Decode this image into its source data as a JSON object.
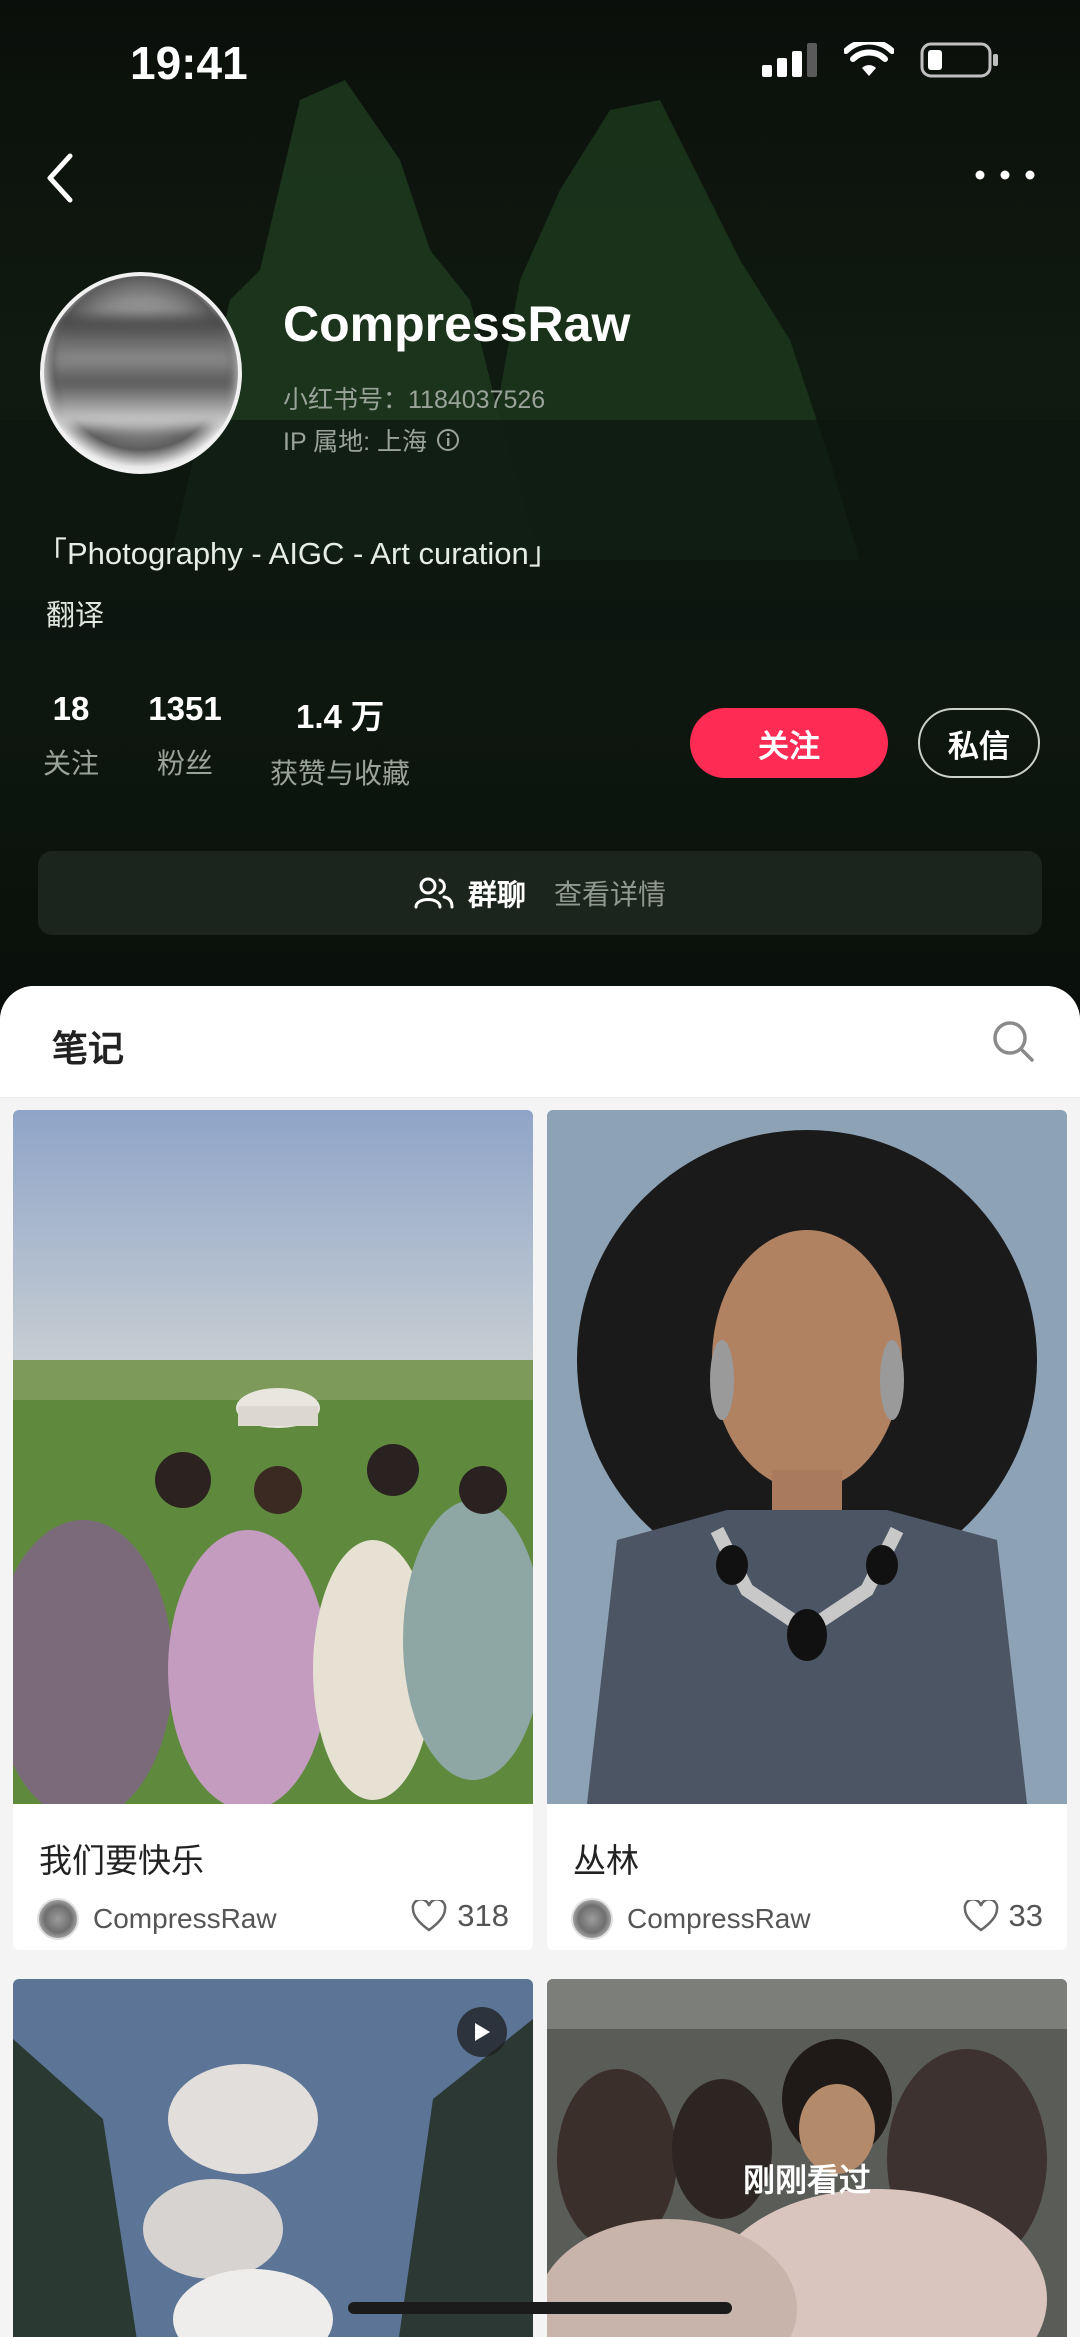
{
  "status_bar": {
    "time": "19:41"
  },
  "profile": {
    "username": "CompressRaw",
    "id_line": "小红书号：1184037526",
    "ip_line": "IP 属地: 上海",
    "bio": "「Photography - AIGC - Art curation」",
    "translate_label": "翻译"
  },
  "stats": [
    {
      "value": "18",
      "label": "关注"
    },
    {
      "value": "1351",
      "label": "粉丝"
    },
    {
      "value": "1.4 万",
      "label": "获赞与收藏"
    }
  ],
  "actions": {
    "follow": "关注",
    "message": "私信"
  },
  "group": {
    "title": "群聊",
    "detail": "查看详情"
  },
  "notes_tab": {
    "label": "笔记"
  },
  "notes": [
    {
      "title": "我们要快乐",
      "author": "CompressRaw",
      "likes": "318"
    },
    {
      "title": "丛林",
      "author": "CompressRaw",
      "likes": "33"
    },
    {
      "title": "",
      "author": "",
      "likes": "",
      "is_video": true
    },
    {
      "overlay": "刚刚看过"
    }
  ],
  "colors": {
    "accent": "#fe2c55",
    "hero_bg": "#0d160f"
  }
}
